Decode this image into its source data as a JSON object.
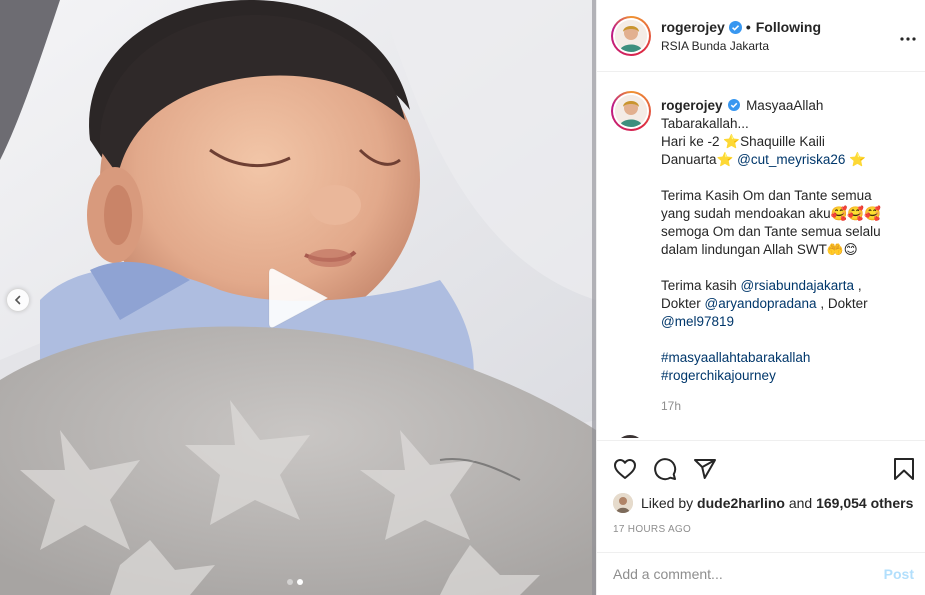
{
  "post": {
    "username": "rogerojey",
    "follow_separator": "•",
    "follow_status": "Following",
    "location": "RSIA Bunda Jakarta",
    "verified": true
  },
  "caption": {
    "username": "rogerojey",
    "line1": "MasyaaAllah",
    "line2": "Tabarakallah...",
    "line3a": "Hari ke -2 ⭐Shaquille Kaili",
    "line4a": "Danuarta⭐ ",
    "mention1": "@cut_meyriska26",
    "line4b": " ⭐",
    "para2_line1": "Terima Kasih Om dan Tante semua",
    "para2_line2": "yang sudah mendoakan aku🥰🥰🥰",
    "para2_line3": "semoga Om dan Tante semua selalu",
    "para2_line4": "dalam lindungan Allah SWT🤲😊",
    "para3_prefix": "Terima kasih ",
    "mention2": "@rsiabundajakarta",
    "para3_sep1": " ,",
    "para3_l2_prefix": "Dokter ",
    "mention3": "@aryandopradana",
    "para3_l2_suffix": " , Dokter",
    "mention4": "@mel97819",
    "hashtag1": "#masyaallahtabarakallah",
    "hashtag2": "#rogerchikajourney",
    "time": "17h"
  },
  "engagement": {
    "liked_prefix": "Liked by ",
    "liked_user": "dude2harlino",
    "liked_and": " and ",
    "liked_count": "169,054 others",
    "posted_ago": "17 HOURS AGO"
  },
  "comment": {
    "placeholder": "Add a comment...",
    "post_label": "Post"
  },
  "media": {
    "type": "video",
    "carousel_index": 2,
    "carousel_total": 2
  },
  "icons": {
    "like": "heart-icon",
    "comment": "comment-icon",
    "share": "share-icon",
    "save": "bookmark-icon",
    "more": "more-options-icon",
    "play": "play-icon",
    "prev": "chevron-left-icon",
    "verified": "verified-badge-icon"
  },
  "colors": {
    "link": "#00376b",
    "verified": "#3897f0",
    "muted": "#8e8e8e",
    "post_disabled": "#b2dffc"
  }
}
